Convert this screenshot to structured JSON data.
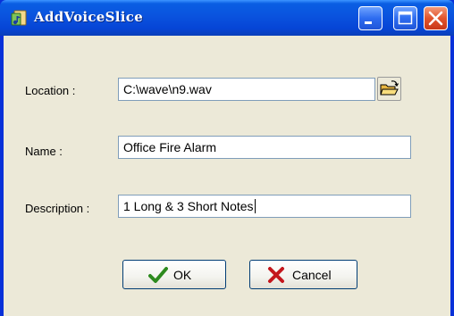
{
  "window": {
    "title": "AddVoiceSlice",
    "controls": {
      "minimize": "minimize-icon",
      "maximize": "maximize-icon",
      "close": "close-icon"
    }
  },
  "form": {
    "location": {
      "label": "Location :",
      "value": "C:\\wave\\n9.wav",
      "browse_icon": "folder-open-icon"
    },
    "name": {
      "label": "Name :",
      "value": "Office Fire Alarm"
    },
    "description": {
      "label": "Description :",
      "value": "1 Long & 3 Short Notes"
    }
  },
  "buttons": {
    "ok": {
      "label": "OK",
      "icon": "check-icon",
      "icon_color": "#2d8a1e"
    },
    "cancel": {
      "label": "Cancel",
      "icon": "x-icon",
      "icon_color": "#c4161c"
    }
  },
  "colors": {
    "titlebar": "#0a53de",
    "dialog_background": "#ece9d8",
    "field_border": "#7f9db9",
    "button_border": "#003c74"
  }
}
